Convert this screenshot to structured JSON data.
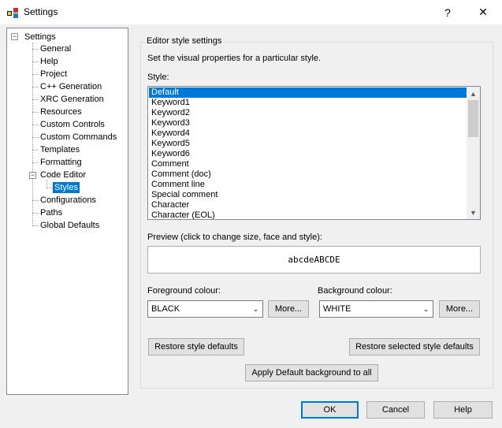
{
  "window": {
    "title": "Settings",
    "help_label": "?",
    "close_label": "✕"
  },
  "tree": {
    "root": "Settings",
    "items": [
      "General",
      "Help",
      "Project",
      "C++ Generation",
      "XRC Generation",
      "Resources",
      "Custom Controls",
      "Custom Commands",
      "Templates",
      "Formatting",
      "Code Editor"
    ],
    "code_editor_child": "Styles",
    "after": [
      "Configurations",
      "Paths",
      "Global Defaults"
    ],
    "selected": "Styles"
  },
  "editor": {
    "group_title": "Editor style settings",
    "description": "Set the visual properties for a particular style.",
    "style_label": "Style:",
    "styles": [
      "Default",
      "Keyword1",
      "Keyword2",
      "Keyword3",
      "Keyword4",
      "Keyword5",
      "Keyword6",
      "Comment",
      "Comment (doc)",
      "Comment line",
      "Special comment",
      "Character",
      "Character (EOL)"
    ],
    "selected_style": "Default",
    "preview_label": "Preview (click to change size, face and style):",
    "preview_text": "abcdeABCDE",
    "foreground_label": "Foreground colour:",
    "foreground_value": "BLACK",
    "background_label": "Background colour:",
    "background_value": "WHITE",
    "more_label": "More...",
    "restore_style_defaults": "Restore style defaults",
    "restore_selected_defaults": "Restore selected style defaults",
    "apply_default_background": "Apply Default background to all"
  },
  "footer": {
    "ok_label": "OK",
    "cancel_label": "Cancel",
    "help_label": "Help"
  },
  "colors": {
    "selection": "#0078d7",
    "window_bg": "#f0f0f0"
  }
}
